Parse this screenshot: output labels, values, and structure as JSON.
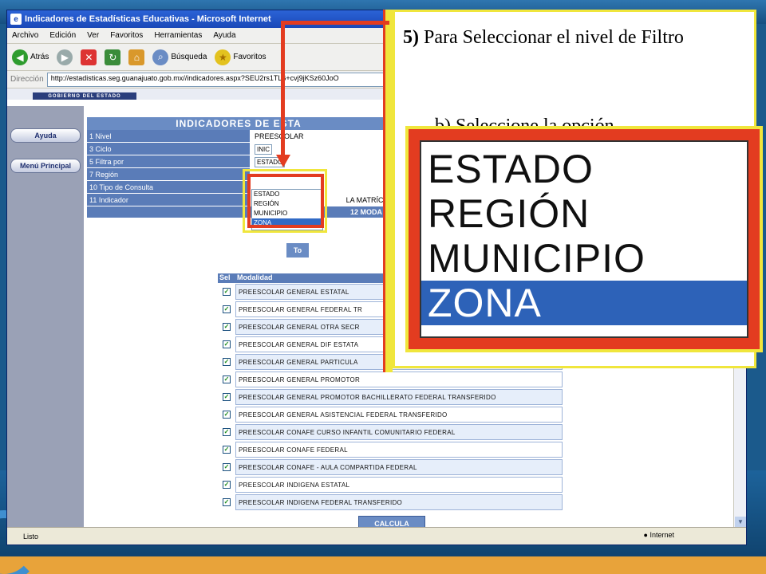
{
  "browser": {
    "title": "Indicadores de Estadísticas Educativas - Microsoft Internet",
    "menu": [
      "Archivo",
      "Edición",
      "Ver",
      "Favoritos",
      "Herramientas",
      "Ayuda"
    ],
    "toolbar": {
      "back": "Atrás",
      "search": "Búsqueda",
      "favorites": "Favoritos"
    },
    "address_label": "Dirección",
    "url": "http://estadisticas.seg.guanajuato.gob.mx//indicadores.aspx?SEU2rs1TL6+cvj9jKSz60JoO",
    "status": "Listo",
    "zone": "Internet"
  },
  "page": {
    "gov_band": "GOBIERNO DEL ESTADO",
    "side_buttons": [
      "Ayuda",
      "Menú Principal"
    ],
    "form_header": "INDICADORES DE ESTA",
    "rows": [
      {
        "label": "1 Nivel",
        "value": "PREESCOLAR"
      },
      {
        "label": "3 Ciclo",
        "value": "INIC"
      },
      {
        "label": "5 Filtra por",
        "value": "ESTADO"
      },
      {
        "label": "7 Región",
        "value": ""
      },
      {
        "label": "10 Tipo de Consulta",
        "value": ""
      },
      {
        "label": "11 Indicador",
        "value": "LA MATRÍCU"
      }
    ],
    "sub_header": "12 MODA",
    "todo_button": "To",
    "dropdown_options": [
      "ESTADO",
      "REGIÓN",
      "MUNICIPIO",
      "ZONA"
    ],
    "dropdown_selected": "ZONA",
    "table_head": {
      "sel": "Sel",
      "modalidad": "Modalidad"
    },
    "modalidades": [
      "PREESCOLAR GENERAL ESTATAL",
      "PREESCOLAR GENERAL FEDERAL TR",
      "PREESCOLAR GENERAL OTRA SECR",
      "PREESCOLAR GENERAL DIF ESTATA",
      "PREESCOLAR GENERAL PARTICULA",
      "PREESCOLAR GENERAL PROMOTOR",
      "PREESCOLAR GENERAL PROMOTOR BACHILLERATO FEDERAL TRANSFERIDO",
      "PREESCOLAR GENERAL ASISTENCIAL FEDERAL TRANSFERIDO",
      "PREESCOLAR CONAFE CURSO INFANTIL COMUNITARIO FEDERAL",
      "PREESCOLAR CONAFE FEDERAL",
      "PREESCOLAR CONAFE - AULA COMPARTIDA FEDERAL",
      "PREESCOLAR INDIGENA ESTATAL",
      "PREESCOLAR INDIGENA FEDERAL TRANSFERIDO"
    ],
    "calc_button": "CALCULA"
  },
  "callout": {
    "step_number": "5)",
    "step_text": "Para Seleccionar el nivel de Filtro",
    "sub_text": "b) Seleccione la opción"
  },
  "zoom": {
    "options": [
      "ESTADO",
      "REGIÓN",
      "MUNICIPIO",
      "ZONA"
    ],
    "selected": "ZONA"
  },
  "colors": {
    "accent": "#e33c20",
    "highlight": "#f0e63c",
    "selection": "#316ac5",
    "header_blue": "#5a7cb8"
  }
}
